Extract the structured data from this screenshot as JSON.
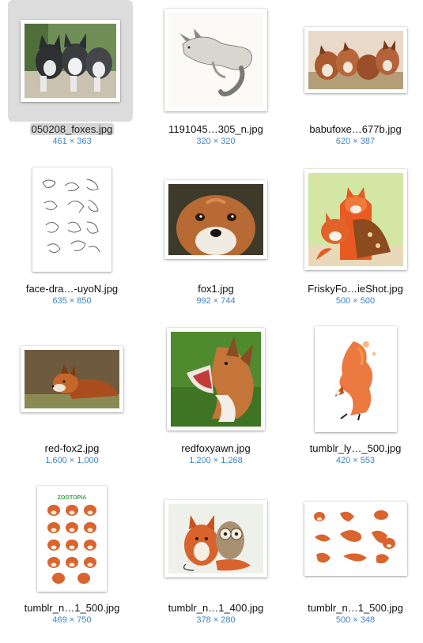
{
  "files": [
    {
      "name": "050208_foxes.jpg",
      "dims": "461 × 363",
      "selected": true,
      "icon": "image-thumbnail-grey-fox-kits"
    },
    {
      "name": "1191045…305_n.jpg",
      "dims": "320 × 320",
      "selected": false,
      "icon": "image-thumbnail-fox-sketch"
    },
    {
      "name": "babufoxe…677b.jpg",
      "dims": "620 × 387",
      "selected": false,
      "icon": "image-thumbnail-fox-cubs"
    },
    {
      "name": "face-dra…-uyoN.jpg",
      "dims": "635 × 850",
      "selected": false,
      "icon": "image-thumbnail-fox-drawings"
    },
    {
      "name": "fox1.jpg",
      "dims": "992 × 744",
      "selected": false,
      "icon": "image-thumbnail-fox-face"
    },
    {
      "name": "FriskyFo…ieShot.jpg",
      "dims": "500 × 500",
      "selected": false,
      "icon": "image-thumbnail-felt-foxes"
    },
    {
      "name": "red-fox2.jpg",
      "dims": "1,600 × 1,000",
      "selected": false,
      "icon": "image-thumbnail-red-fox"
    },
    {
      "name": "redfoxyawn.jpg",
      "dims": "1,200 × 1,268",
      "selected": false,
      "icon": "image-thumbnail-yawning-fox"
    },
    {
      "name": "tumblr_ly…_500.jpg",
      "dims": "420 × 553",
      "selected": false,
      "icon": "image-thumbnail-watercolor-fox"
    },
    {
      "name": "tumblr_n…1_500.jpg",
      "dims": "469 × 750",
      "selected": false,
      "icon": "image-thumbnail-zootopia-sheet"
    },
    {
      "name": "tumblr_n…1_400.jpg",
      "dims": "378 × 280",
      "selected": false,
      "icon": "image-thumbnail-fox-and-owl"
    },
    {
      "name": "tumblr_n…1_500.jpg",
      "dims": "500 × 348",
      "selected": false,
      "icon": "image-thumbnail-fox-poses"
    }
  ],
  "zootopia_logo_text": "ZOOTOPIA",
  "colors": {
    "selection_bg": "#dcdcdc",
    "dims_text": "#3d84c6",
    "name_text": "#111111"
  }
}
